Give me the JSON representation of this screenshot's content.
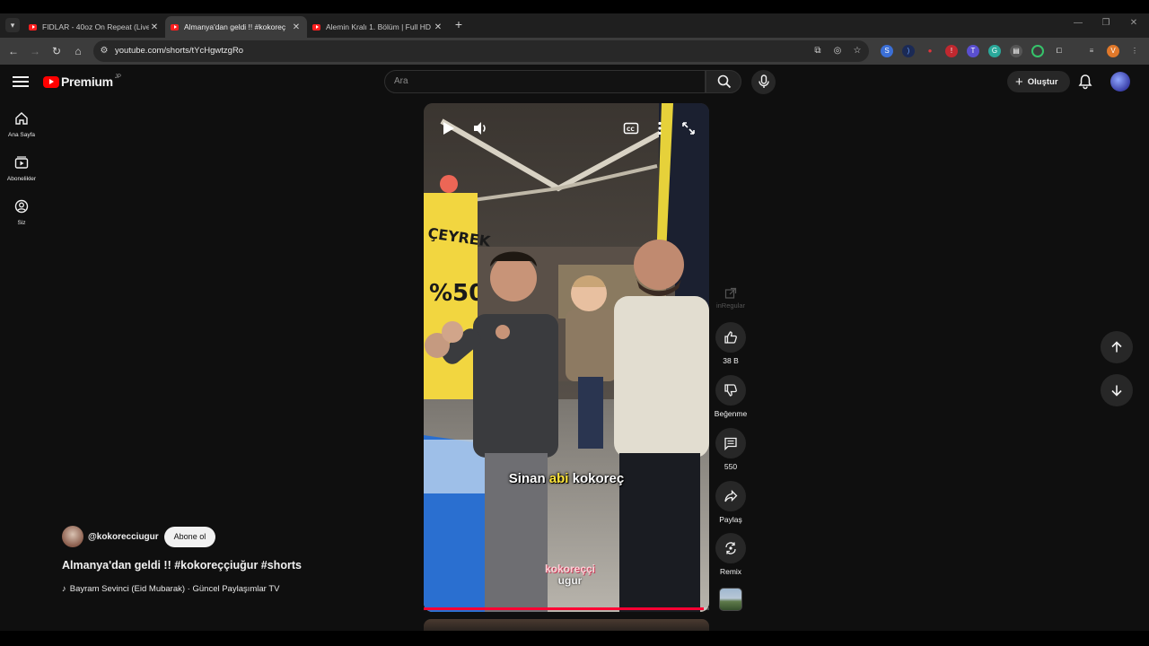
{
  "browser": {
    "tabs": [
      {
        "title": "FIDLAR - 40oz On Repeat (Live",
        "active": false
      },
      {
        "title": "Almanya'dan geldi !! #kokoreç",
        "active": true
      },
      {
        "title": "Alemin Kralı 1. Bölüm | Full HD",
        "active": false
      }
    ],
    "new_tab": "+",
    "url": "youtube.com/shorts/tYcHgwtzgRo"
  },
  "masthead": {
    "logo_text": "Premium",
    "logo_sup": "JP",
    "search_placeholder": "Ara",
    "create_label": "Oluştur"
  },
  "sidebar": {
    "items": [
      {
        "label": "Ana Sayfa",
        "icon": "home-icon"
      },
      {
        "label": "Abonelikler",
        "icon": "subscriptions-icon"
      },
      {
        "label": "Siz",
        "icon": "account-icon"
      }
    ]
  },
  "video": {
    "caption_pre": "Sinan",
    "caption_highlight": "abi",
    "caption_post": "kokoreç",
    "watermark_line1": "kokoreççi",
    "watermark_line2": "ugur",
    "progress": 0.98
  },
  "actions": {
    "external_label": "inRegular",
    "like_count": "38 B",
    "dislike_label": "Beğenme",
    "comment_count": "550",
    "share_label": "Paylaş",
    "remix_label": "Remix"
  },
  "meta": {
    "channel": "@kokorecciugur",
    "subscribe_label": "Abone ol",
    "title": "Almanya'dan geldi !!  #kokoreççiuğur #shorts",
    "audio": "Bayram Sevinci (Eid Mubarak) · Güncel Paylaşımlar TV"
  },
  "colors": {
    "accent": "#ff0033",
    "background": "#0f0f0f",
    "caption_highlight": "#ffe53b"
  }
}
